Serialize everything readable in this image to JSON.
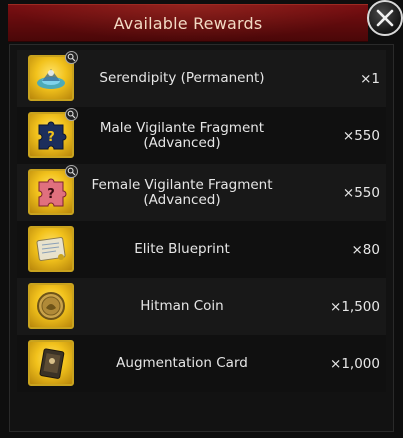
{
  "header": {
    "title": "Available Rewards"
  },
  "rewards": [
    {
      "name": "Serendipity (Permanent)",
      "qty": "×1",
      "icon": "serendipity-icon",
      "has_preview": true
    },
    {
      "name": "Male Vigilante Fragment\n(Advanced)",
      "qty": "×550",
      "icon": "male-fragment-icon",
      "has_preview": true
    },
    {
      "name": "Female Vigilante Fragment\n(Advanced)",
      "qty": "×550",
      "icon": "female-fragment-icon",
      "has_preview": true
    },
    {
      "name": "Elite Blueprint",
      "qty": "×80",
      "icon": "blueprint-icon",
      "has_preview": false
    },
    {
      "name": "Hitman Coin",
      "qty": "×1,500",
      "icon": "coin-icon",
      "has_preview": false
    },
    {
      "name": "Augmentation Card",
      "qty": "×1,000",
      "icon": "card-icon",
      "has_preview": false
    }
  ],
  "colors": {
    "title_bar": "#6a0d10",
    "icon_frame": "#f2c21c",
    "text": "#e6e6e6"
  }
}
